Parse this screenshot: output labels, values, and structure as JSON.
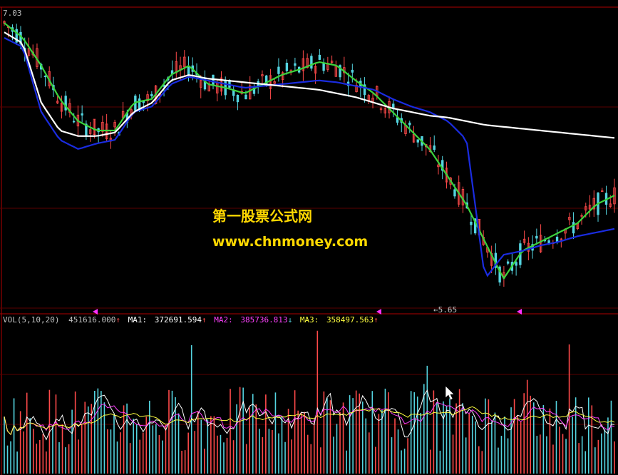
{
  "price_panel": {
    "high_marker": "7.03",
    "low_marker": "5.65",
    "colors": {
      "grid": "#7a0000",
      "axis": "#b00000",
      "up": "#ff4a4a",
      "down": "#54d4e0",
      "line_white": "#ffffff",
      "line_green": "#3cd43c",
      "line_blue": "#1a2ce0"
    }
  },
  "watermark": {
    "line1": "第一股票公式网",
    "line2": "www.chnmoney.com",
    "color": "#ffd800"
  },
  "volume_panel": {
    "label": "VOL(5,10,20)",
    "value": "451616.000",
    "value_arrow": "↑",
    "ma1_label": "MA1:",
    "ma1_value": "372691.594",
    "ma1_arrow": "↑",
    "ma2_label": "MA2:",
    "ma2_value": "385736.813",
    "ma2_arrow": "↓",
    "ma3_label": "MA3:",
    "ma3_value": "358497.563",
    "ma3_arrow": "↑",
    "colors": {
      "label": "#c0c0c0",
      "ma1": "#ffffff",
      "ma2": "#ff40ff",
      "ma3": "#ffff40"
    }
  },
  "chart_data": [
    {
      "type": "candlestick",
      "title": "",
      "ylim": [
        5.5,
        7.1
      ],
      "series": [
        {
          "values": [
            7.03,
            6.95,
            6.8,
            6.62,
            6.5,
            6.45,
            6.45,
            6.6,
            6.62,
            6.75,
            6.8,
            6.7,
            6.68,
            6.65,
            6.7,
            6.75,
            6.78,
            6.82,
            6.8,
            6.72,
            6.65,
            6.55,
            6.45,
            6.35,
            6.2,
            6.05,
            5.85,
            5.65,
            5.8,
            5.85,
            5.9,
            5.95,
            6.05,
            6.1
          ]
        },
        {
          "values": [
            6.95,
            6.9,
            6.55,
            6.4,
            6.35,
            6.38,
            6.4,
            6.55,
            6.58,
            6.7,
            6.74,
            6.72,
            6.7,
            6.68,
            6.69,
            6.7,
            6.71,
            6.72,
            6.71,
            6.69,
            6.67,
            6.62,
            6.58,
            6.55,
            6.5,
            6.4,
            5.65,
            5.78,
            5.8,
            5.83,
            5.85,
            5.88,
            5.9,
            5.92
          ]
        },
        {
          "values": [
            6.98,
            6.92,
            6.6,
            6.45,
            6.42,
            6.42,
            6.44,
            6.55,
            6.6,
            6.72,
            6.75,
            6.73,
            6.72,
            6.71,
            6.7,
            6.69,
            6.68,
            6.67,
            6.65,
            6.63,
            6.6,
            6.57,
            6.55,
            6.53,
            6.52,
            6.5,
            6.48,
            6.47,
            6.46,
            6.45,
            6.44,
            6.43,
            6.42,
            6.41
          ]
        }
      ]
    },
    {
      "type": "bar",
      "title": "",
      "series": [
        {
          "name": "VOL",
          "values": [
            451616
          ]
        },
        {
          "name": "MA1",
          "values": [
            372691.594
          ]
        },
        {
          "name": "MA2",
          "values": [
            385736.813
          ]
        },
        {
          "name": "MA3",
          "values": [
            358497.563
          ]
        }
      ]
    }
  ]
}
